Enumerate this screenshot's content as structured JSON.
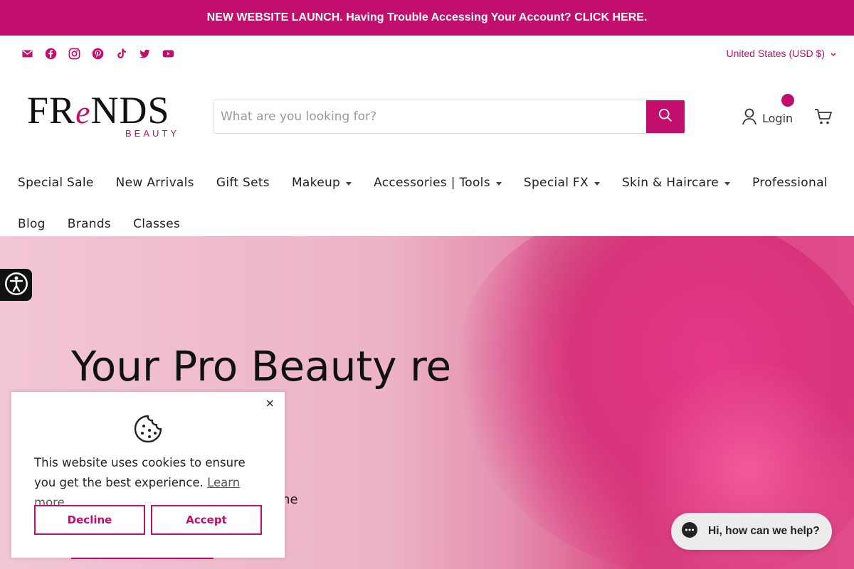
{
  "announcement": "NEW WEBSITE LAUNCH. Having Trouble Accessing Your Account? CLICK HERE.",
  "socials": [
    "email-icon",
    "facebook-icon",
    "instagram-icon",
    "pinterest-icon",
    "tiktok-icon",
    "twitter-icon",
    "youtube-icon"
  ],
  "currency": "United States (USD $)",
  "logo": {
    "word_pre": "FR",
    "word_e": "e",
    "word_post": "NDS",
    "sub": "BEAUTY"
  },
  "search": {
    "placeholder": "What are you looking for?"
  },
  "account": {
    "login": "Login"
  },
  "nav": {
    "row1": [
      {
        "label": "Special Sale",
        "dropdown": false
      },
      {
        "label": "New Arrivals",
        "dropdown": false
      },
      {
        "label": "Gift Sets",
        "dropdown": false
      },
      {
        "label": "Makeup",
        "dropdown": true
      },
      {
        "label": "Accessories | Tools",
        "dropdown": true
      },
      {
        "label": "Special FX",
        "dropdown": true
      },
      {
        "label": "Skin & Haircare",
        "dropdown": true
      },
      {
        "label": "Professional",
        "dropdown": false
      }
    ],
    "row2": [
      {
        "label": "Blog",
        "dropdown": false
      },
      {
        "label": "Brands",
        "dropdown": false
      },
      {
        "label": "Classes",
        "dropdown": false
      }
    ]
  },
  "hero": {
    "title": "Your Pro Beauty re Since",
    "subtitle": "me"
  },
  "cookie": {
    "text": "This website uses cookies to ensure you get the best experience.",
    "learn_more": "Learn more",
    "decline": "Decline",
    "accept": "Accept",
    "close": "×"
  },
  "chat": {
    "label": "Hi, how can we help?"
  },
  "colors": {
    "brand": "#c20f6e"
  }
}
